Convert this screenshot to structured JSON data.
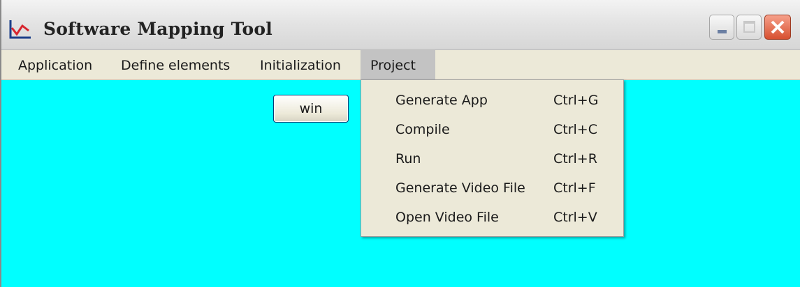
{
  "window": {
    "title": "Software Mapping Tool",
    "icon": "chart-icon"
  },
  "title_buttons": {
    "minimize": "minimize-icon",
    "maximize": "maximize-icon",
    "close": "close-icon"
  },
  "menubar": {
    "items": [
      {
        "label": "Application"
      },
      {
        "label": "Define elements"
      },
      {
        "label": "Initialization"
      },
      {
        "label": "Project",
        "active": true
      }
    ]
  },
  "client": {
    "background": "#00ffff",
    "button_label": "win"
  },
  "project_menu": {
    "items": [
      {
        "label": "Generate App",
        "shortcut": "Ctrl+G"
      },
      {
        "label": "Compile",
        "shortcut": "Ctrl+C"
      },
      {
        "label": "Run",
        "shortcut": "Ctrl+R"
      },
      {
        "label": "Generate Video File",
        "shortcut": "Ctrl+F"
      },
      {
        "label": "Open Video File",
        "shortcut": "Ctrl+V"
      }
    ]
  }
}
